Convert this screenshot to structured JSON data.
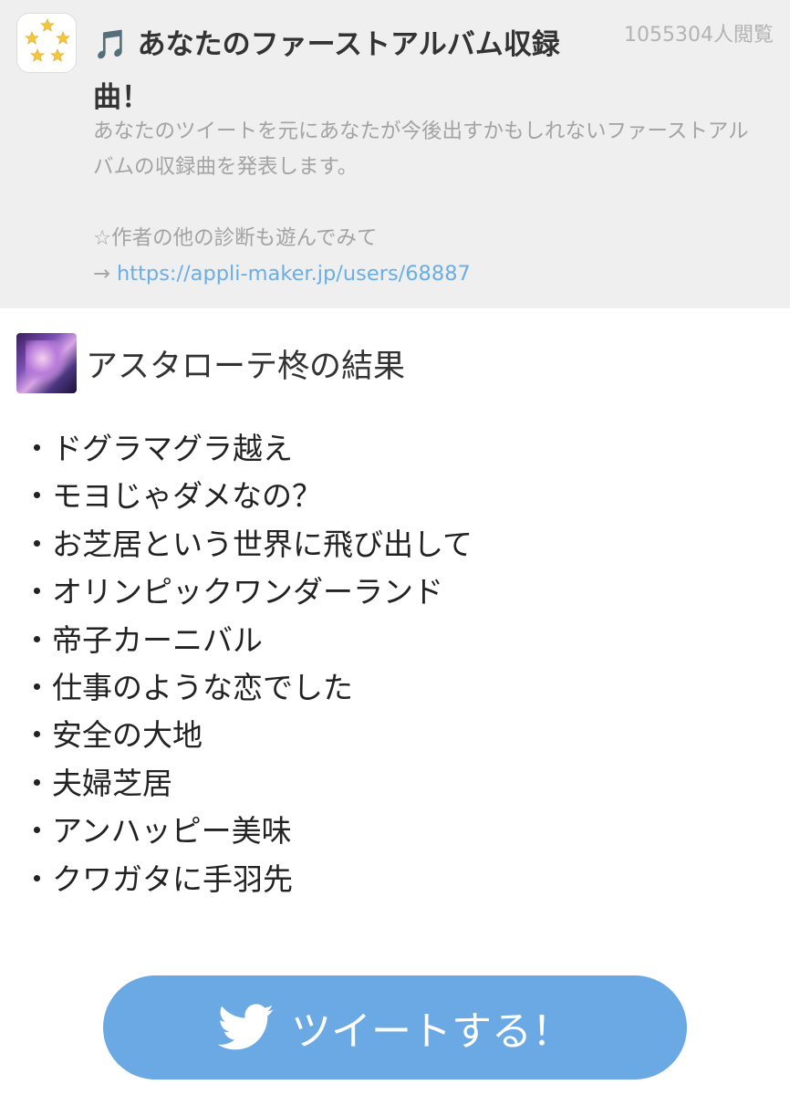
{
  "header": {
    "app_icon": "five-stars-icon",
    "title_icon": "music-note-icon",
    "title_note": "🎵",
    "title": "あなたのファーストアルバム収録曲！",
    "views": "1055304人閲覧",
    "description_line1": "あなたのツイートを元にあなたが今後出すかもしれないファーストアルバムの収録曲を発表します。",
    "description_line2": "☆作者の他の診断も遊んでみて",
    "link_prefix": "→ ",
    "link": "https://appli-maker.jp/users/68887"
  },
  "result": {
    "avatar_icon": "user-avatar",
    "title": "アスタローテ柊の結果",
    "tracks": [
      "・ドグラマグラ越え",
      "・モヨじゃダメなの？",
      "・お芝居という世界に飛び出して",
      "・オリンピックワンダーランド",
      "・帝子カーニバル",
      "・仕事のような恋でした",
      "・安全の大地",
      "・夫婦芝居",
      "・アンハッピー美味",
      "・クワガタに手羽先"
    ]
  },
  "tweet_button": {
    "icon": "twitter-bird-icon",
    "label": "ツイートする！",
    "color": "#6aa9e4"
  }
}
